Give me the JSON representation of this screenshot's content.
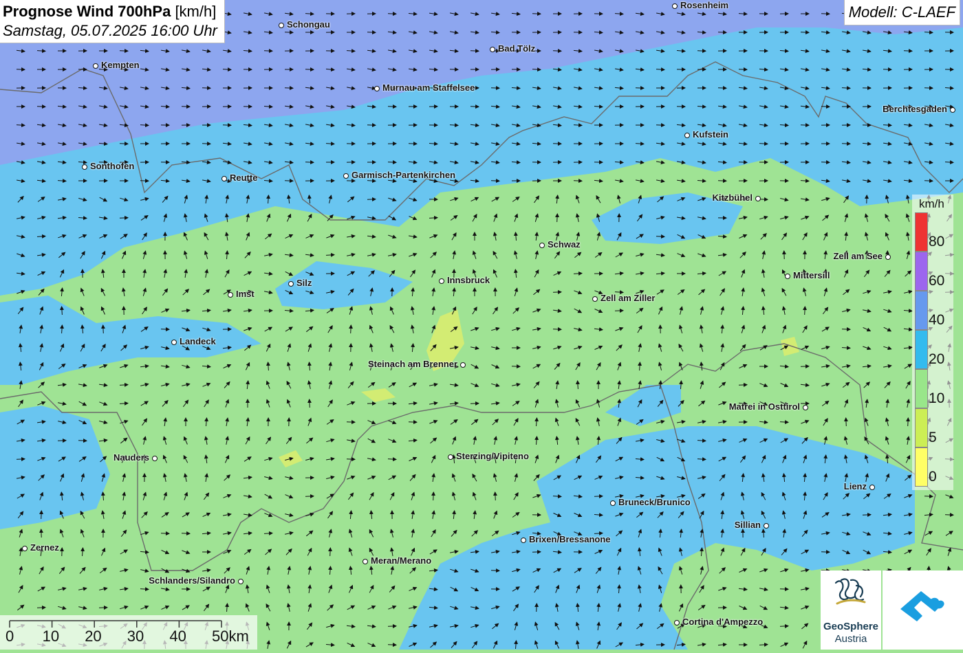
{
  "title": {
    "main": "Prognose Wind 700hPa",
    "unit": "[km/h]",
    "datetime": "Samstag, 05.07.2025 16:00 Uhr"
  },
  "model": "Modell: C-LAEF",
  "legend": {
    "unit": "km/h",
    "labels": [
      "80",
      "60",
      "40",
      "20",
      "10",
      "5",
      "0"
    ],
    "colors": [
      "#ee3333",
      "#9c66ee",
      "#6699ee",
      "#33bbee",
      "#99e68a",
      "#ccee55",
      "#ffff66"
    ]
  },
  "scale": {
    "labels": [
      "0",
      "10",
      "20",
      "30",
      "40",
      "50km"
    ]
  },
  "colors": {
    "strong": "#8da6ef",
    "medium": "#69c5f0",
    "light": "#9fe394",
    "weak": "#d3ec73"
  },
  "cities": [
    {
      "name": "Rosenheim"
    },
    {
      "name": "Schongau"
    },
    {
      "name": "Bad Tölz"
    },
    {
      "name": "Kempten"
    },
    {
      "name": "Murnau am Staffelsee"
    },
    {
      "name": "Berchtesgaden"
    },
    {
      "name": "Kufstein"
    },
    {
      "name": "Sonthofen"
    },
    {
      "name": "Reutte"
    },
    {
      "name": "Garmisch-Partenkirchen"
    },
    {
      "name": "Kitzbühel"
    },
    {
      "name": "Schwaz"
    },
    {
      "name": "Zell am See"
    },
    {
      "name": "Mittersill"
    },
    {
      "name": "Silz"
    },
    {
      "name": "Innsbruck"
    },
    {
      "name": "Imst"
    },
    {
      "name": "Zell am Ziller"
    },
    {
      "name": "Landeck"
    },
    {
      "name": "Steinach am Brenner"
    },
    {
      "name": "Matrei in Osttirol"
    },
    {
      "name": "Nauders"
    },
    {
      "name": "Sterzing/Vipiteno"
    },
    {
      "name": "Lienz"
    },
    {
      "name": "Bruneck/Brunico"
    },
    {
      "name": "Sillian"
    },
    {
      "name": "Brixen/Bressanone"
    },
    {
      "name": "Zernez"
    },
    {
      "name": "Meran/Merano"
    },
    {
      "name": "Schlanders/Silandro"
    },
    {
      "name": "Cortina d'Ampezzo"
    }
  ],
  "logos": {
    "geosphere_line1": "GeoSphere",
    "geosphere_line2": "Austria"
  }
}
